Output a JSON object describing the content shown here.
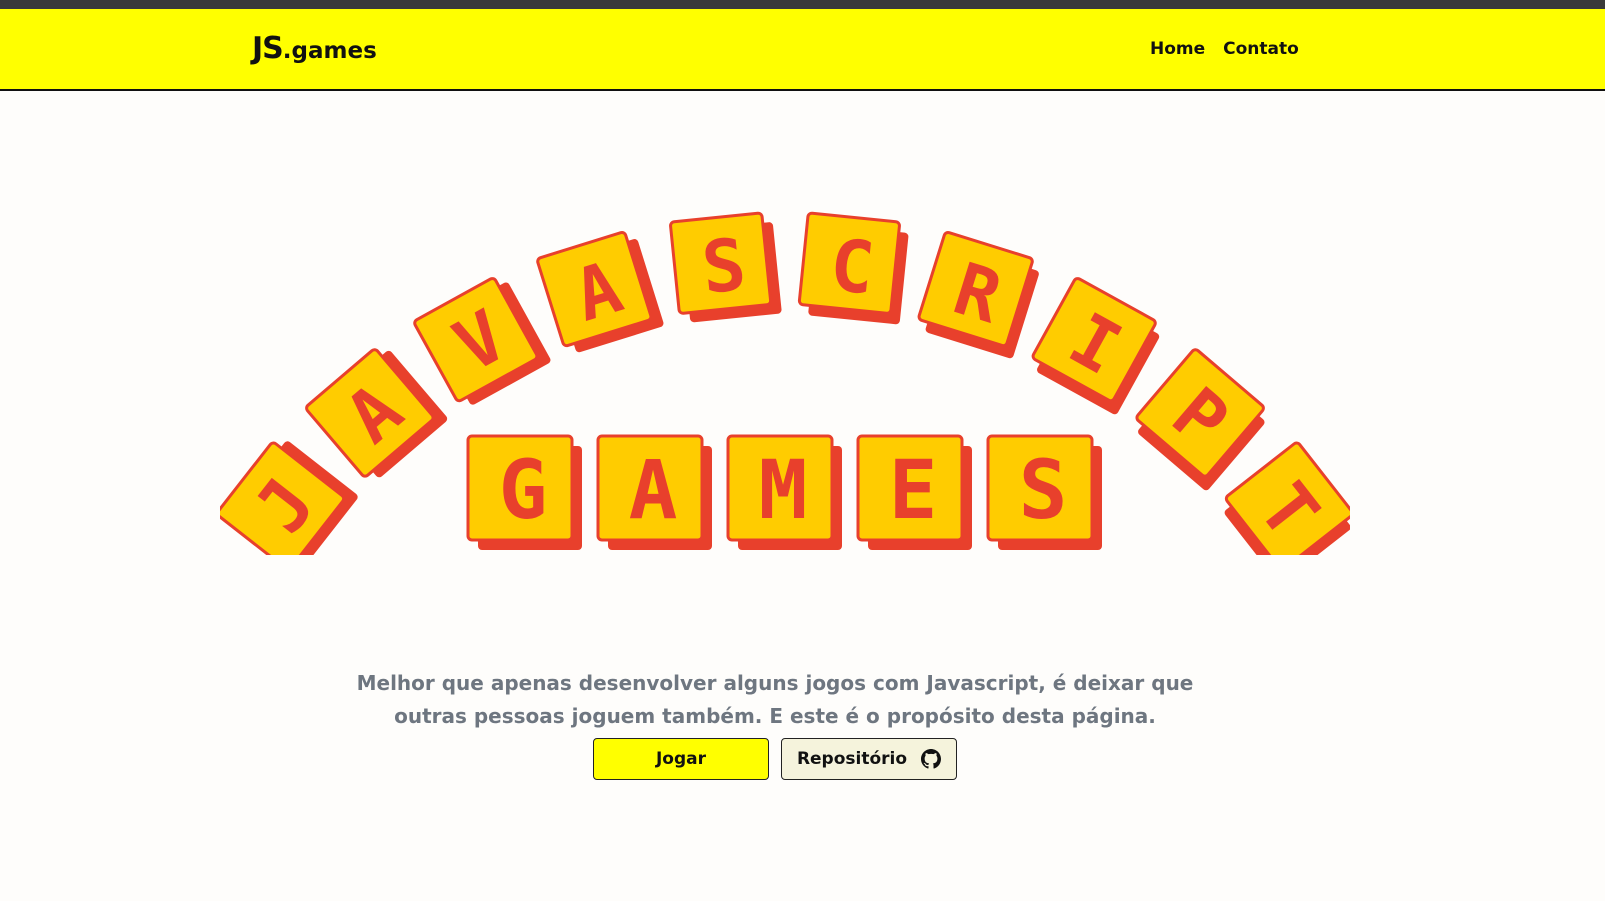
{
  "brand": {
    "logo_js": "JS",
    "logo_games": ".games"
  },
  "nav": {
    "items": [
      {
        "label": "Home"
      },
      {
        "label": "Contato"
      }
    ]
  },
  "hero": {
    "title_top": "JAVASCRIPT",
    "title_bottom": "GAMES",
    "colors": {
      "face": "#ffcc00",
      "shadow": "#e8402c"
    },
    "description": "Melhor que apenas desenvolver alguns jogos com Javascript, é deixar que outras pessoas joguem também. E este é o propósito desta página."
  },
  "actions": {
    "play_label": "Jogar",
    "repo_label": "Repositório",
    "repo_icon": "github-icon"
  },
  "colors": {
    "navbar_bg": "#ffff00",
    "topbar_bg": "#3a3a3a",
    "text_muted": "#6e7680"
  }
}
